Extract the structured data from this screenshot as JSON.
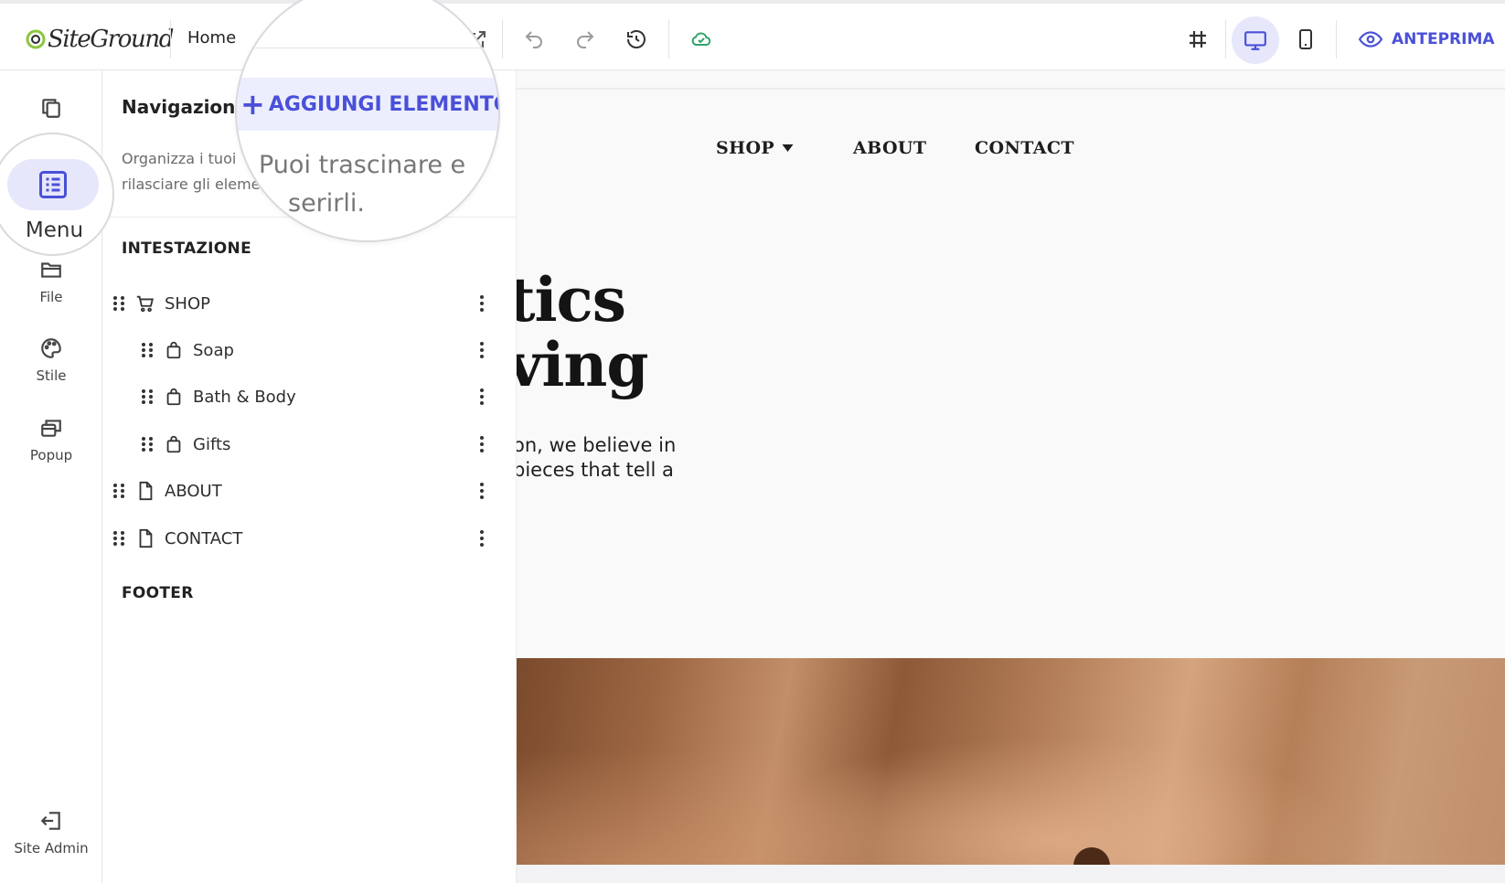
{
  "topbar": {
    "brand": "SiteGround",
    "page_name": "Home",
    "preview_label": "ANTEPRIMA"
  },
  "rail": {
    "items": [
      {
        "label": "",
        "icon": "pages-icon"
      },
      {
        "label": "Menu",
        "icon": "menu-list-icon"
      },
      {
        "label": "File",
        "icon": "folder-icon"
      },
      {
        "label": "Stile",
        "icon": "palette-icon"
      },
      {
        "label": "Popup",
        "icon": "popup-icon"
      }
    ],
    "site_admin": "Site Admin"
  },
  "panel": {
    "title": "Navigazione",
    "desc_line1": "Organizza i tuoi ",
    "desc_line2": "rilasciare gli eleme",
    "add_button": "AGGIUNGI ELEMENTO",
    "hint_line1": "Puoi trascinare e",
    "hint_line2": "serirli.",
    "header_section": "INTESTAZIONE",
    "footer_section": "FOOTER",
    "items": [
      {
        "label": "SHOP",
        "icon": "cart-icon",
        "level": 0
      },
      {
        "label": "Soap",
        "icon": "bag-icon",
        "level": 1
      },
      {
        "label": "Bath & Body",
        "icon": "bag-icon",
        "level": 1
      },
      {
        "label": "Gifts",
        "icon": "bag-icon",
        "level": 1
      },
      {
        "label": "ABOUT",
        "icon": "page-icon",
        "level": 0
      },
      {
        "label": "CONTACT",
        "icon": "page-icon",
        "level": 0
      }
    ]
  },
  "site": {
    "nav": [
      "SHOP",
      "ABOUT",
      "CONTACT"
    ],
    "hero_line1": "tics",
    "hero_line2": "ving",
    "para_line1": "on, we believe in",
    "para_line2": "pieces that tell a"
  },
  "colors": {
    "accent": "#4a50d8",
    "accent_bg": "#e6e7fb",
    "cloud_green": "#2fa36b"
  }
}
